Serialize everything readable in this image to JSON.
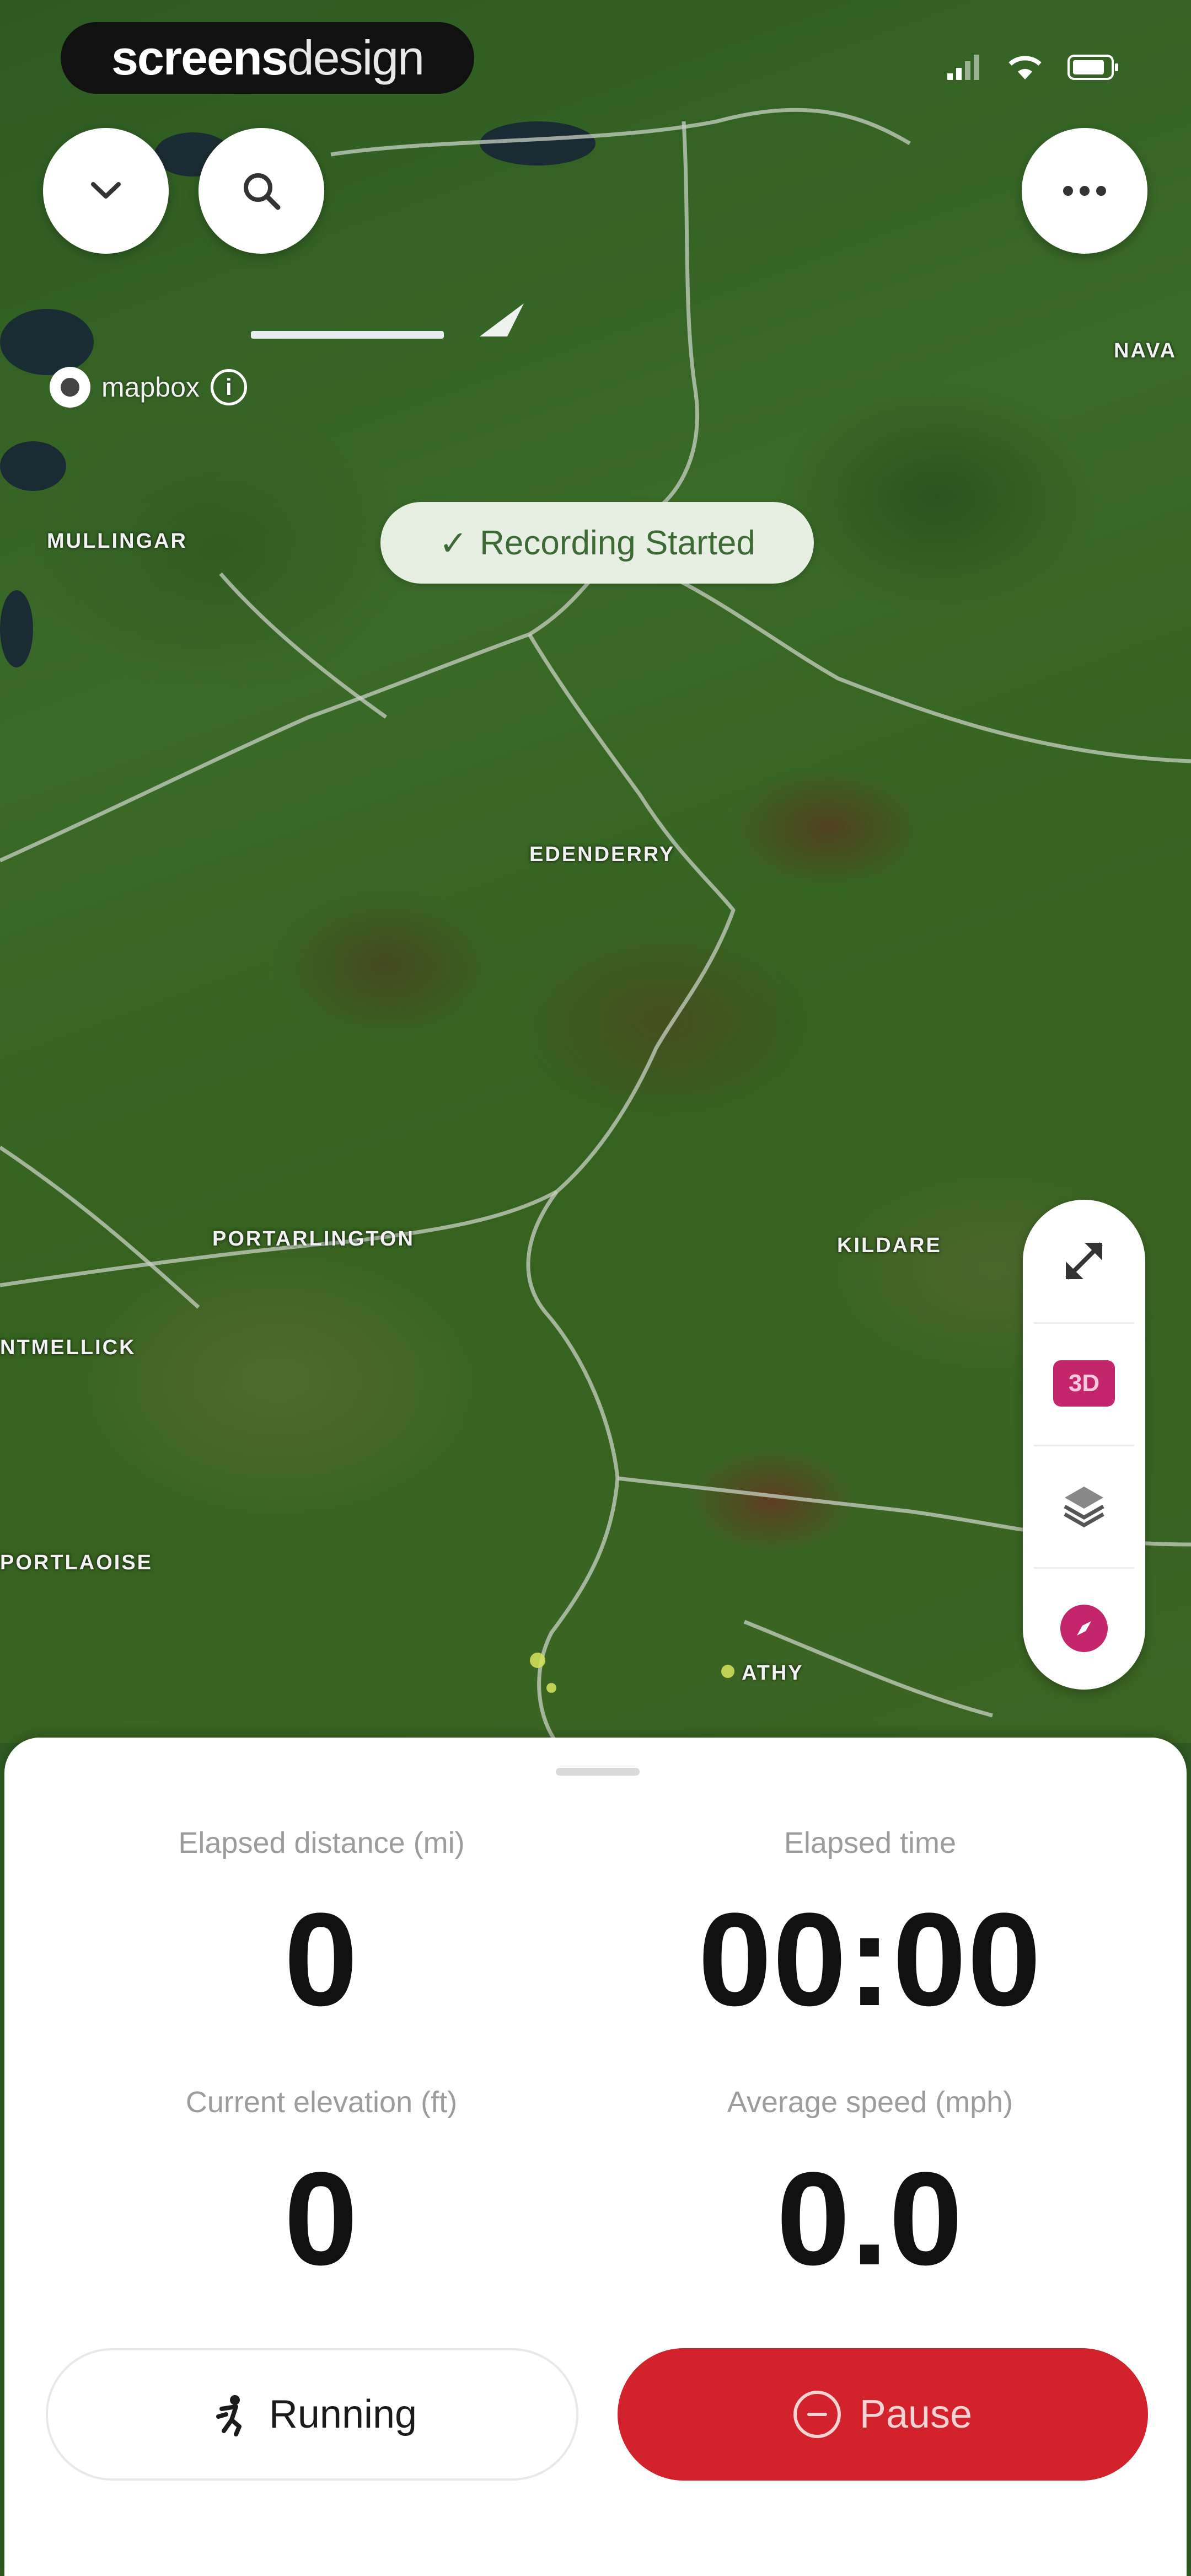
{
  "watermark": {
    "bold": "screens",
    "light": "design"
  },
  "map": {
    "toast": {
      "check": "✓",
      "text": "Recording Started"
    },
    "attribution": "mapbox",
    "info_symbol": "i",
    "places": [
      {
        "name": "MULLINGAR"
      },
      {
        "name": "EDENDERRY"
      },
      {
        "name": "PORTARLINGTON"
      },
      {
        "name": "KILDARE"
      },
      {
        "name": "NTMELLICK"
      },
      {
        "name": "PORTLAOISE"
      },
      {
        "name": "ATHY"
      },
      {
        "name": "NAVA"
      }
    ],
    "controls": {
      "mode_3d": "3D"
    }
  },
  "stats": [
    {
      "label": "Elapsed distance (mi)",
      "value": "0"
    },
    {
      "label": "Elapsed time",
      "value": "00:00"
    },
    {
      "label": "Current elevation (ft)",
      "value": "0"
    },
    {
      "label": "Average speed (mph)",
      "value": "0.0"
    }
  ],
  "actions": {
    "activity": "Running",
    "pause": "Pause"
  },
  "colors": {
    "accent": "#d2222c",
    "magenta": "#c4266c",
    "toast_bg": "#e7efe2",
    "toast_text": "#3d6b36"
  },
  "icons": [
    "chevron-down-icon",
    "search-icon",
    "more-icon",
    "expand-icon",
    "layers-icon",
    "compass-icon",
    "running-icon",
    "pause-icon",
    "check-icon",
    "signal-icon",
    "wifi-icon",
    "battery-icon"
  ]
}
